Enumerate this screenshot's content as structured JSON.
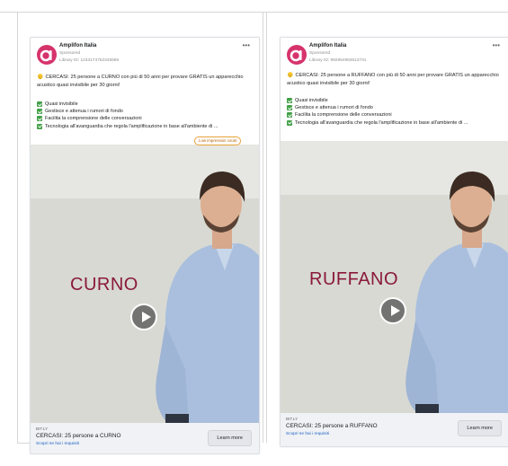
{
  "ads": [
    {
      "id": "left",
      "page_name": "Amplifon Italia",
      "sponsored": "Sponsored",
      "library_id": "Library ID: 1233174752345586",
      "body": "CERCASI: 25 persone a CURNO con più di 50 anni per provare GRATIS un apparecchio acustico quasi invisibile per 30 giorni!",
      "checklist": [
        "Quasi invisibile",
        "Gestisce e attenua i rumori di fondo",
        "Facilita la comprensione delle conversazioni",
        "Tecnologia all'avanguardia che regola l'amplificazione in base all'ambiente di ..."
      ],
      "badge": "Low impression count",
      "video_overlay": "CURNO",
      "domain": "BIT.LY",
      "headline": "CERCASI: 25 persone a CURNO",
      "description": "Scopri se hai i requisiti",
      "cta": "Learn more"
    },
    {
      "id": "right",
      "page_name": "Amplifon Italia",
      "sponsored": "Sponsored",
      "library_id": "Library ID: 992954963613731",
      "body": "CERCASI: 25 persone a RUFFANO con più di 50 anni per provare GRATIS un apparecchio acustico quasi invisibile per 30 giorni!",
      "checklist": [
        "Quasi invisibile",
        "Gestisce e attenua i rumori di fondo",
        "Facilita la comprensione delle conversazioni",
        "Tecnologia all'avanguardia che regola l'amplificazione in base all'ambiente di ..."
      ],
      "video_overlay": "RUFFANO",
      "domain": "BIT.LY",
      "headline": "CERCASI: 25 persone a RUFFANO",
      "description": "Scopri se hai i requisiti",
      "cta": "Learn more"
    }
  ],
  "icons": {
    "logo": "amplifon-logo-icon",
    "more": "more-options-icon",
    "check": "green-check-icon",
    "play": "play-icon",
    "person": "person-emoji-icon"
  },
  "colors": {
    "brand_logo": "#d6336c",
    "check_green": "#43a047",
    "overlay_text": "#8a1a3a",
    "link_blue": "#1c62c4",
    "badge_border": "#e7a23a"
  }
}
